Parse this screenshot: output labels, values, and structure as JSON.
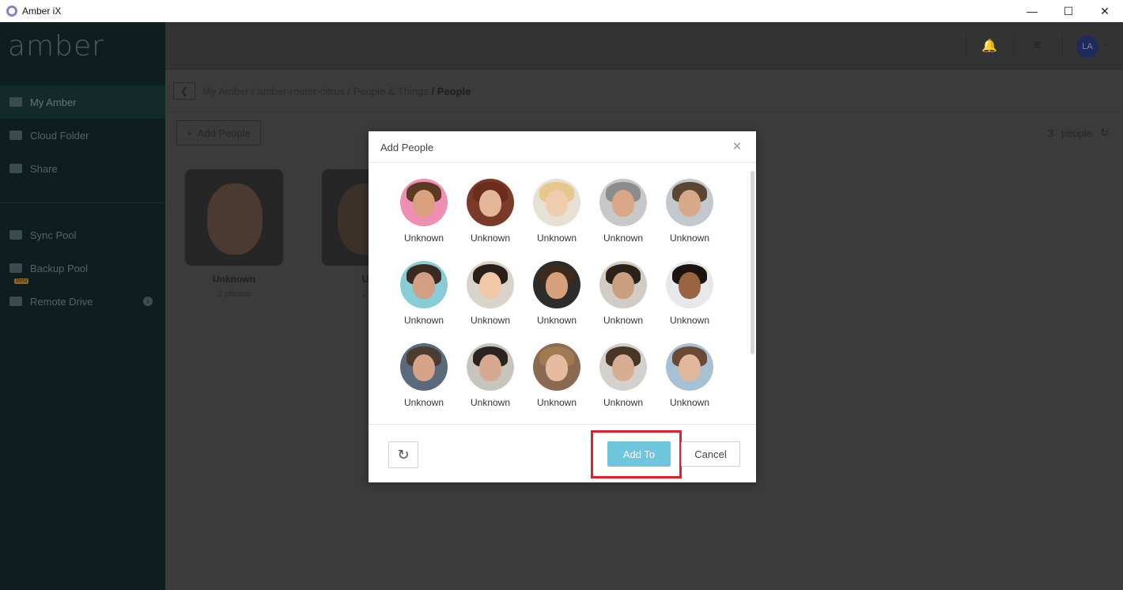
{
  "window": {
    "title": "Amber iX",
    "controls": [
      "minimize",
      "maximize",
      "close"
    ]
  },
  "sidebar": {
    "logo": "amber",
    "items": [
      {
        "label": "My Amber",
        "icon": "home-icon",
        "active": true
      },
      {
        "label": "Cloud Folder",
        "icon": "folder-icon",
        "active": false
      },
      {
        "label": "Share",
        "icon": "share-icon",
        "active": false
      },
      {
        "label": "Sync Pool",
        "icon": "sync-icon",
        "active": false
      },
      {
        "label": "Backup Pool",
        "icon": "backup-icon",
        "active": false
      },
      {
        "label": "Remote Drive",
        "icon": "drive-icon",
        "active": false,
        "badge": "Beta"
      }
    ]
  },
  "topbar": {
    "avatar_initials": "LA"
  },
  "breadcrumb": {
    "parts": [
      "My Amber",
      "amber-router-citrus",
      "People & Things"
    ],
    "current": "People"
  },
  "toolbar": {
    "add_people_label": "Add People",
    "count_value": "3",
    "count_label": "people"
  },
  "people_cards": [
    {
      "name": "Unknown",
      "subtitle": "2 photos"
    },
    {
      "name": "Unk",
      "subtitle": "2 ph"
    }
  ],
  "modal": {
    "title": "Add People",
    "faces": [
      {
        "label": "Unknown",
        "bg": "#f08fb4",
        "skin": "#d8a07c",
        "hair": "#5a3a22"
      },
      {
        "label": "Unknown",
        "bg": "#7a3a2a",
        "skin": "#e3b69a",
        "hair": "#6a2c1c"
      },
      {
        "label": "Unknown",
        "bg": "#e7e0d4",
        "skin": "#f1cdb0",
        "hair": "#e6c98a"
      },
      {
        "label": "Unknown",
        "bg": "#c8c8c8",
        "skin": "#d9a688",
        "hair": "#8d8d8d"
      },
      {
        "label": "Unknown",
        "bg": "#c2c8cc",
        "skin": "#d8a88a",
        "hair": "#5a4632"
      },
      {
        "label": "Unknown",
        "bg": "#88ccd6",
        "skin": "#d49e82",
        "hair": "#3a2a22"
      },
      {
        "label": "Unknown",
        "bg": "#d8d4cc",
        "skin": "#f0c8a8",
        "hair": "#2a1e18"
      },
      {
        "label": "Unknown",
        "bg": "#2e2c2a",
        "skin": "#d6a07a",
        "hair": "#3c2a1e"
      },
      {
        "label": "Unknown",
        "bg": "#d2ccc6",
        "skin": "#caa080",
        "hair": "#2c221c"
      },
      {
        "label": "Unknown",
        "bg": "#e6e8ea",
        "skin": "#9a6440",
        "hair": "#1c1410"
      },
      {
        "label": "Unknown",
        "bg": "#5a6a7c",
        "skin": "#d6a288",
        "hair": "#4a3c30"
      },
      {
        "label": "Unknown",
        "bg": "#c8c4be",
        "skin": "#d6a890",
        "hair": "#2c2420"
      },
      {
        "label": "Unknown",
        "bg": "#8a6a52",
        "skin": "#e6bca0",
        "hair": "#a07a52"
      },
      {
        "label": "Unknown",
        "bg": "#d4d0cc",
        "skin": "#d8ae92",
        "hair": "#4a3626"
      },
      {
        "label": "Unknown",
        "bg": "#a8c0d4",
        "skin": "#e2b89c",
        "hair": "#6a4a34"
      }
    ],
    "add_to_label": "Add To",
    "cancel_label": "Cancel",
    "accent_color": "#6ec6dc",
    "highlight_color": "#e0202a"
  }
}
